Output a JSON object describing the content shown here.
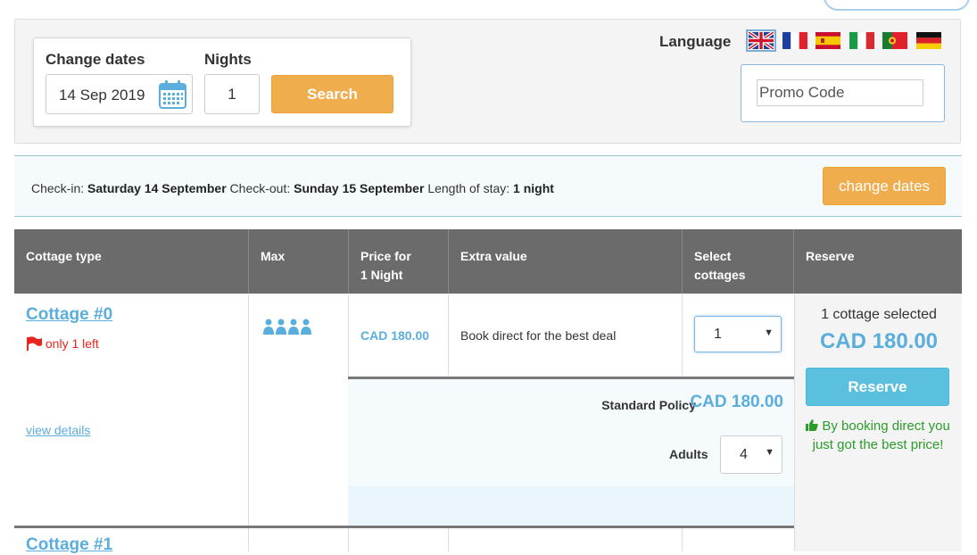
{
  "search": {
    "change_dates_label": "Change dates",
    "date_value": "14 Sep 2019",
    "nights_label": "Nights",
    "nights_value": "1",
    "search_button": "Search"
  },
  "language": {
    "label": "Language",
    "flags": [
      "uk-flag-icon",
      "france-flag-icon",
      "spain-flag-icon",
      "italy-flag-icon",
      "portugal-flag-icon",
      "germany-flag-icon"
    ],
    "selected": "uk-flag-icon"
  },
  "promo": {
    "placeholder": "Promo Code"
  },
  "stay_info": {
    "checkin_label": "Check-in:",
    "checkin_value": "Saturday 14 September",
    "checkout_label": "Check-out:",
    "checkout_value": "Sunday 15 September",
    "length_label": "Length of stay:",
    "length_value": "1 night",
    "change_button": "change dates"
  },
  "table": {
    "headers": {
      "cottage_type": "Cottage type",
      "max": "Max",
      "price_line1": "Price for",
      "price_line2": "1 Night",
      "extra_value": "Extra value",
      "select_line1": "Select",
      "select_line2": "cottages",
      "reserve": "Reserve"
    },
    "rows": [
      {
        "name": "Cottage #0",
        "availability": "only 1 left",
        "view_details": "view details",
        "max_guests": 4,
        "price": "CAD 180.00",
        "extra": "Book direct for the best deal",
        "select_value": "1",
        "policy_label": "Standard Policy",
        "policy_price": "CAD 180.00",
        "adults_label": "Adults",
        "adults_value": "4"
      },
      {
        "name": "Cottage #1"
      }
    ]
  },
  "reserve": {
    "selected_text": "1 cottage selected",
    "total": "CAD 180.00",
    "button": "Reserve",
    "best_deal": "By booking direct you just got the best price!"
  },
  "colors": {
    "accent_orange": "#f0ad4e",
    "link_blue": "#5aaedb",
    "reserve_blue": "#5bc0de",
    "header_gray": "#6b6b6b",
    "alert_red": "#e8231c",
    "success_green": "#2a9d2a"
  }
}
